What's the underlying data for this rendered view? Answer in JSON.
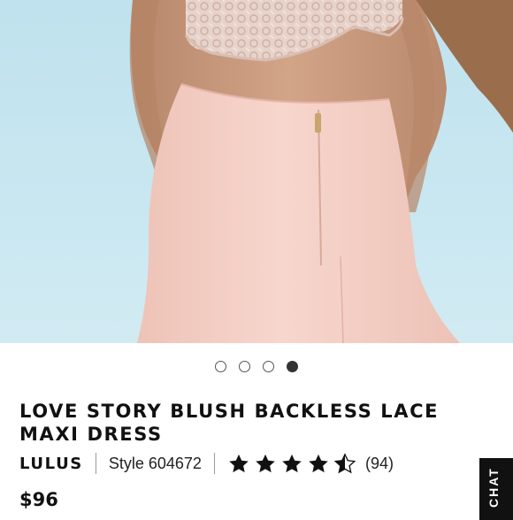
{
  "carousel": {
    "slide_count": 4,
    "active_index": 3
  },
  "product": {
    "title": "LOVE STORY BLUSH BACKLESS LACE MAXI DRESS",
    "brand": "LULUS",
    "style_label": "Style 604672",
    "rating": 4.5,
    "rating_max": 5,
    "review_count_label": "(94)",
    "price": "$96"
  },
  "chat": {
    "label": "CHAT"
  },
  "colors": {
    "background": "#ffffff",
    "text": "#111111",
    "sky": "#c6e6f0",
    "dress": "#f4cfc5",
    "skin": "#c99a7d",
    "chat_tab": "#111111"
  }
}
